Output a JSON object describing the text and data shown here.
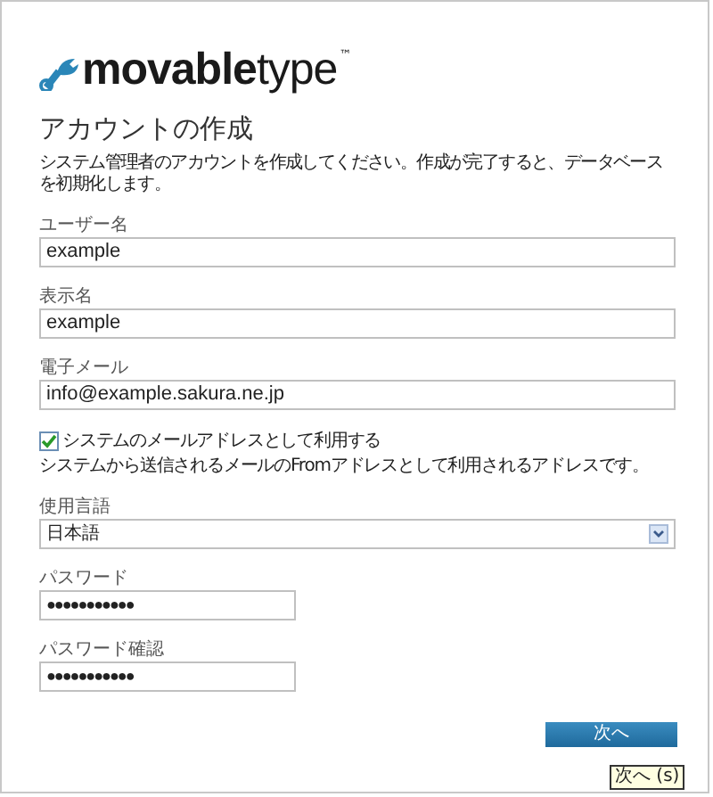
{
  "logo": {
    "bold": "movable",
    "light": "type",
    "mark": "™"
  },
  "title": "アカウントの作成",
  "description": "システム管理者のアカウントを作成してください。作成が完了すると、データベースを初期化します。",
  "fields": [
    {
      "kind": "text",
      "label": "ユーザー名",
      "value": "example"
    },
    {
      "kind": "text",
      "label": "表示名",
      "value": "example"
    },
    {
      "kind": "text",
      "label": "電子メール",
      "value": "info@example.sakura.ne.jp"
    },
    {
      "kind": "checkbox",
      "label": "システムのメールアドレスとして利用する",
      "checked": true,
      "hint": "システムから送信されるメールのFromアドレスとして利用されるアドレスです。"
    },
    {
      "kind": "select",
      "label": "使用言語",
      "value": "日本語"
    },
    {
      "kind": "password",
      "label": "パスワード",
      "value": "●●●●●●●●●●●"
    },
    {
      "kind": "password",
      "label": "パスワード確認",
      "value": "●●●●●●●●●●●"
    }
  ],
  "next_button": {
    "label": "次へ",
    "tooltip": "次へ (s)"
  }
}
